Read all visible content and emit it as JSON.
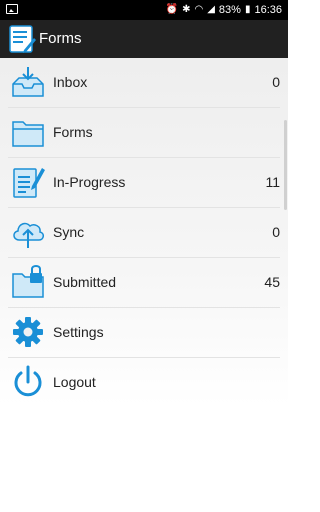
{
  "status_bar": {
    "battery": "83%",
    "time": "16:36"
  },
  "app_bar": {
    "title": "Forms"
  },
  "menu": {
    "items": [
      {
        "label": "Inbox",
        "count": "0",
        "icon": "inbox-icon"
      },
      {
        "label": "Forms",
        "count": "",
        "icon": "folder-icon"
      },
      {
        "label": "In-Progress",
        "count": "11",
        "icon": "edit-form-icon"
      },
      {
        "label": "Sync",
        "count": "0",
        "icon": "cloud-upload-icon"
      },
      {
        "label": "Submitted",
        "count": "45",
        "icon": "locked-folder-icon"
      },
      {
        "label": "Settings",
        "count": "",
        "icon": "gear-icon"
      },
      {
        "label": "Logout",
        "count": "",
        "icon": "power-icon"
      }
    ]
  },
  "colors": {
    "accent": "#1a8fd6",
    "app_bar": "#212121",
    "status_bar": "#000000"
  }
}
